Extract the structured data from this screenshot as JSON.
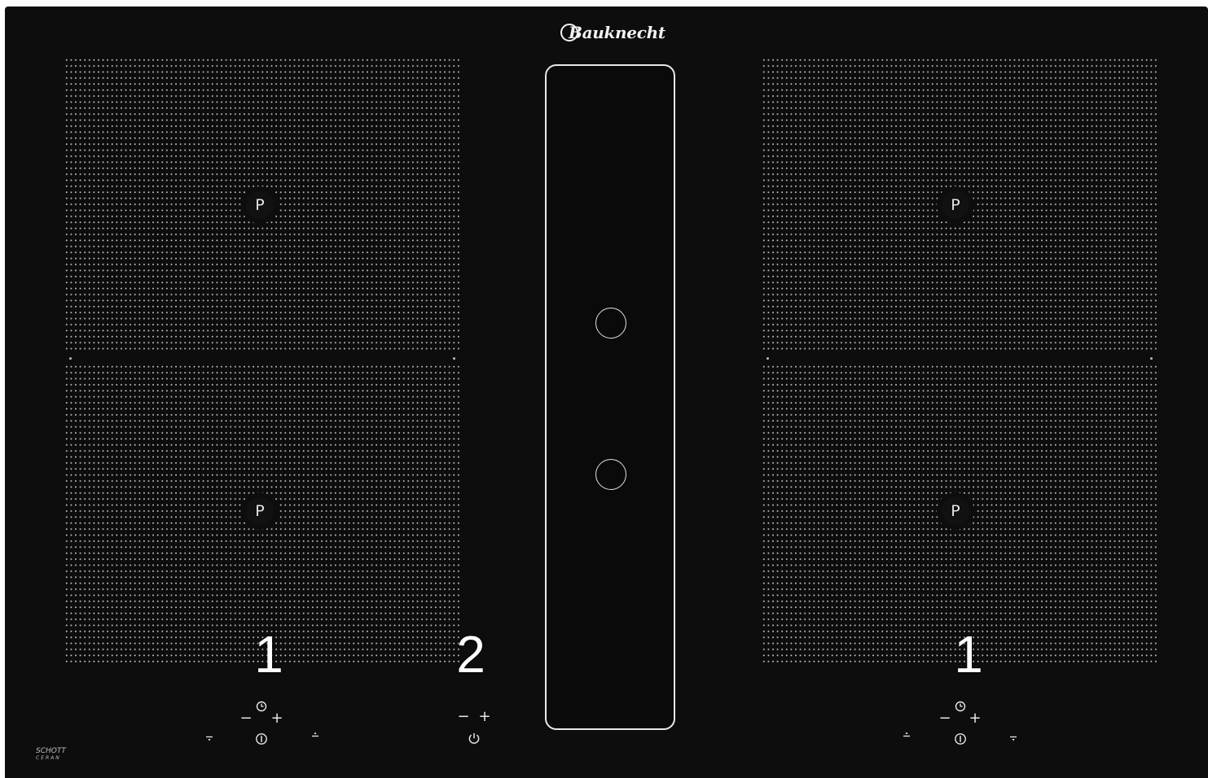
{
  "brand": {
    "logo_text": "Bauknecht",
    "glass_line1": "SCHOTT",
    "glass_line2": "CERAN"
  },
  "zones": {
    "left_top_label": "P",
    "left_bottom_label": "P",
    "right_top_label": "P",
    "right_bottom_label": "P"
  },
  "callouts": {
    "left": "1",
    "center": "2",
    "right": "1"
  },
  "left_controls": {
    "timer_icon": "clock-icon",
    "minus": "−",
    "plus": "+",
    "power_icon": "power-icon",
    "down_icon": "arrow-down-icon",
    "up_icon": "arrow-up-icon"
  },
  "hood_controls": {
    "minus": "−",
    "plus": "+",
    "power_icon": "power-icon"
  },
  "right_controls": {
    "timer_icon": "clock-icon",
    "minus": "−",
    "plus": "+",
    "power_icon": "power-icon",
    "down_icon": "arrow-down-icon",
    "up_icon": "arrow-up-icon"
  },
  "colors": {
    "glass": "#0d0d0d",
    "marking": "#e8e8e8",
    "callout": "#ffffff"
  }
}
